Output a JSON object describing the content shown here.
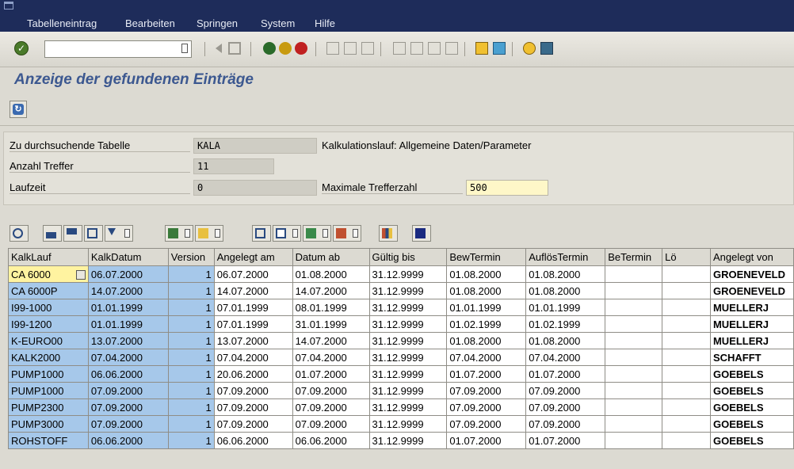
{
  "menu": [
    "Tabelleneintrag",
    "Bearbeiten",
    "Springen",
    "System",
    "Hilfe"
  ],
  "toolbar": {
    "command_value": ""
  },
  "page_title": "Anzeige der gefundenen Einträge",
  "header": {
    "table_label": "Zu durchsuchende Tabelle",
    "table_value": "KALA",
    "table_desc": "Kalkulationslauf: Allgemeine Daten/Parameter",
    "hits_label": "Anzahl Treffer",
    "hits_value": "11",
    "runtime_label": "Laufzeit",
    "runtime_value": "0",
    "max_label": "Maximale Trefferzahl",
    "max_value": "500"
  },
  "grid": {
    "columns": [
      "KalkLauf",
      "KalkDatum",
      "Version",
      "Angelegt am",
      "Datum ab",
      "Gültig bis",
      "BewTermin",
      "AuflösTermin",
      "BeTermin",
      "Lö",
      "Angelegt von"
    ],
    "rows": [
      [
        "CA 6000",
        "06.07.2000",
        "1",
        "06.07.2000",
        "01.08.2000",
        "31.12.9999",
        "01.08.2000",
        "01.08.2000",
        "",
        "",
        "GROENEVELD"
      ],
      [
        "CA 6000P",
        "14.07.2000",
        "1",
        "14.07.2000",
        "14.07.2000",
        "31.12.9999",
        "01.08.2000",
        "01.08.2000",
        "",
        "",
        "GROENEVELD"
      ],
      [
        "I99-1000",
        "01.01.1999",
        "1",
        "07.01.1999",
        "08.01.1999",
        "31.12.9999",
        "01.01.1999",
        "01.01.1999",
        "",
        "",
        "MUELLERJ"
      ],
      [
        "I99-1200",
        "01.01.1999",
        "1",
        "07.01.1999",
        "31.01.1999",
        "31.12.9999",
        "01.02.1999",
        "01.02.1999",
        "",
        "",
        "MUELLERJ"
      ],
      [
        "K-EURO00",
        "13.07.2000",
        "1",
        "13.07.2000",
        "14.07.2000",
        "31.12.9999",
        "01.08.2000",
        "01.08.2000",
        "",
        "",
        "MUELLERJ"
      ],
      [
        "KALK2000",
        "07.04.2000",
        "1",
        "07.04.2000",
        "07.04.2000",
        "31.12.9999",
        "07.04.2000",
        "07.04.2000",
        "",
        "",
        "SCHAFFT"
      ],
      [
        "PUMP1000",
        "06.06.2000",
        "1",
        "20.06.2000",
        "01.07.2000",
        "31.12.9999",
        "01.07.2000",
        "01.07.2000",
        "",
        "",
        "GOEBELS"
      ],
      [
        "PUMP1000",
        "07.09.2000",
        "1",
        "07.09.2000",
        "07.09.2000",
        "31.12.9999",
        "07.09.2000",
        "07.09.2000",
        "",
        "",
        "GOEBELS"
      ],
      [
        "PUMP2300",
        "07.09.2000",
        "1",
        "07.09.2000",
        "07.09.2000",
        "31.12.9999",
        "07.09.2000",
        "07.09.2000",
        "",
        "",
        "GOEBELS"
      ],
      [
        "PUMP3000",
        "07.09.2000",
        "1",
        "07.09.2000",
        "07.09.2000",
        "31.12.9999",
        "07.09.2000",
        "07.09.2000",
        "",
        "",
        "GOEBELS"
      ],
      [
        "ROHSTOFF",
        "06.06.2000",
        "1",
        "06.06.2000",
        "06.06.2000",
        "31.12.9999",
        "01.07.2000",
        "01.07.2000",
        "",
        "",
        "GOEBELS"
      ]
    ]
  }
}
